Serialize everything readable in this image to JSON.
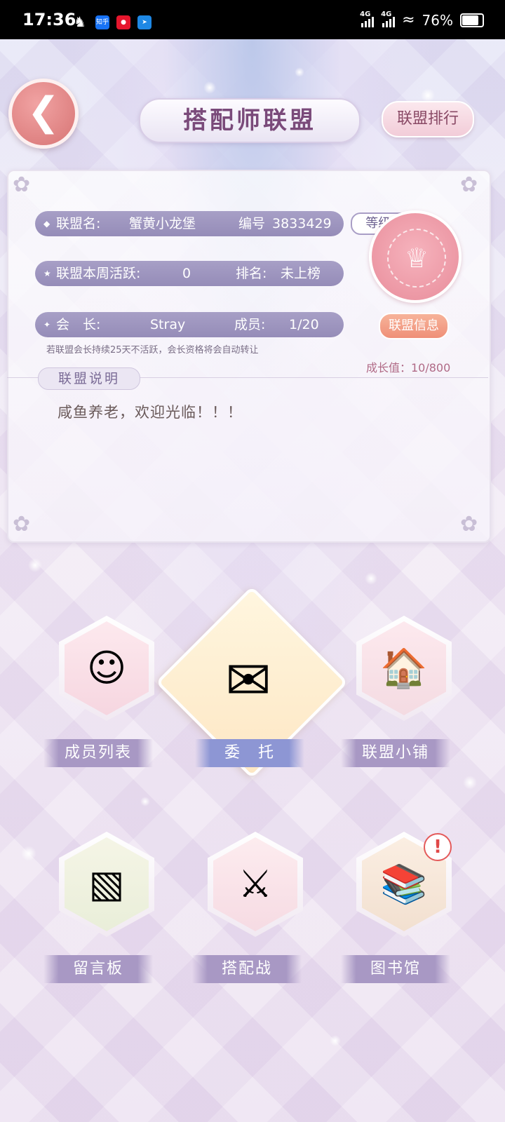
{
  "status_bar": {
    "time": "17:36",
    "apps": [
      "qq-icon",
      "zhihu-icon",
      "weibo-icon",
      "app-icon"
    ],
    "zhihu_label": "知乎",
    "network": [
      "4G",
      "4G"
    ],
    "battery": "76%"
  },
  "header": {
    "back_icon": "arrow-left-icon",
    "title": "搭配师联盟",
    "rank_button": "联盟排行"
  },
  "alliance": {
    "name_label": "联盟名:",
    "name": "蟹黄小龙堡",
    "id_label": "编号",
    "id": "3833429",
    "level": "等级1",
    "weekly_active_label": "联盟本周活跃:",
    "weekly_active": "0",
    "rank_label": "排名:",
    "rank": "未上榜",
    "leader_label": "会　长:",
    "leader": "Stray",
    "members_label": "成员:",
    "members": "1/20",
    "info_button": "联盟信息",
    "notice": "若联盟会长持续25天不活跃，会长资格将会自动转让",
    "growth": "成长值：10/800",
    "desc_title": "联盟说明",
    "desc_text": "咸鱼养老，欢迎光临！！！"
  },
  "features": [
    {
      "label": "成员列表",
      "icon": "members-portrait-icon"
    },
    {
      "label": "委　托",
      "icon": "letter-quill-icon"
    },
    {
      "label": "联盟小铺",
      "icon": "shop-icon"
    },
    {
      "label": "留言板",
      "icon": "chalkboard-icon"
    },
    {
      "label": "搭配战",
      "icon": "crossed-swords-icon"
    },
    {
      "label": "图书馆",
      "icon": "library-icon"
    }
  ],
  "library_alert": "!",
  "colors": {
    "accent_purple": "#a898c4",
    "back_button": "#d77474",
    "info_button": "#ef8f78",
    "alert": "#e04848"
  }
}
